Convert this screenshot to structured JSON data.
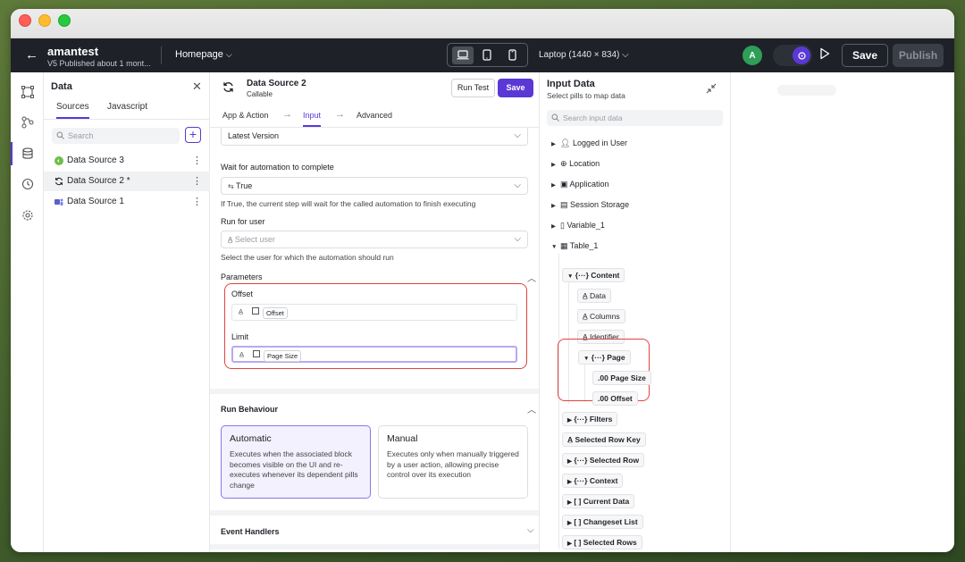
{
  "topbar": {
    "app_name": "amantest",
    "app_subtitle": "V5 Published about 1 mont...",
    "page_selector": "Homepage",
    "device_label": "Laptop (1440 × 834)",
    "avatar_initial": "A",
    "save_label": "Save",
    "publish_label": "Publish"
  },
  "data_panel": {
    "title": "Data",
    "tabs": [
      "Sources",
      "Javascript"
    ],
    "search_placeholder": "Search",
    "add_label": "+",
    "items": [
      {
        "label": "Data Source 3",
        "icon": "green-source-icon"
      },
      {
        "label": "Data Source 2 *",
        "icon": "refresh-icon"
      },
      {
        "label": "Data Source 1",
        "icon": "teams-icon"
      }
    ]
  },
  "input_panel": {
    "title": "Data Source 2",
    "subtitle": "Callable",
    "run_test_label": "Run Test",
    "save_label": "Save",
    "steps": [
      "App & Action",
      "Input",
      "Advanced"
    ],
    "version_value": "Latest Version",
    "wait_label": "Wait for automation to complete",
    "wait_value": "True",
    "wait_hint": "If True, the current step will wait for the called automation to finish executing",
    "run_for_user_label": "Run for user",
    "run_for_user_placeholder": "Select user",
    "run_for_user_hint": "Select the user for which the automation should run",
    "parameters_label": "Parameters",
    "params": [
      {
        "label": "Offset",
        "pill": "Offset"
      },
      {
        "label": "Limit",
        "pill": "Page Size"
      }
    ],
    "run_behaviour_label": "Run Behaviour",
    "behaviours": [
      {
        "title": "Automatic",
        "desc": "Executes when the associated block becomes visible on the UI and re-executes whenever its dependent pills change"
      },
      {
        "title": "Manual",
        "desc": "Executes only when manually triggered by a user action, allowing precise control over its execution"
      }
    ],
    "event_handlers_label": "Event Handlers"
  },
  "input_data": {
    "title": "Input Data",
    "subtitle": "Select pills to map data",
    "search_placeholder": "Search input data",
    "root_items": [
      "Logged in User",
      "Location",
      "Application",
      "Session Storage",
      "Variable_1",
      "Table_1"
    ],
    "content_label": "Content",
    "content_children": [
      "Data",
      "Columns",
      "Identifier"
    ],
    "page_label": "Page",
    "page_children": [
      "Page Size",
      "Offset"
    ],
    "table_items": [
      "Filters",
      "Selected Row Key",
      "Selected Row",
      "Context",
      "Current Data",
      "Changeset List",
      "Selected Rows"
    ]
  }
}
